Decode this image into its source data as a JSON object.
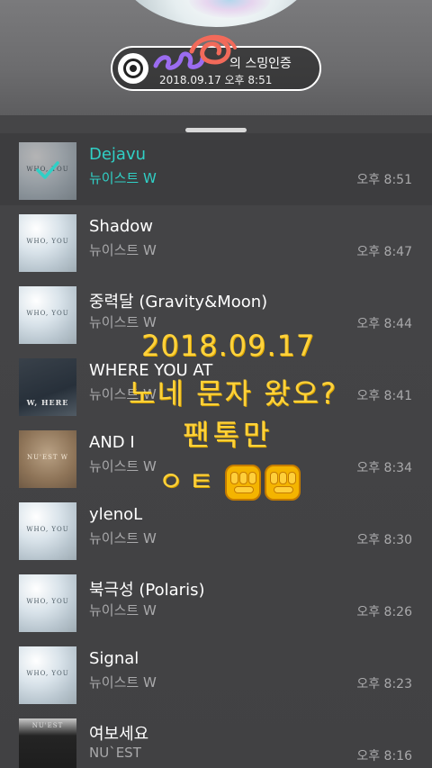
{
  "stream_card": {
    "title_suffix": "의 스밍인증",
    "datetime": "2018.09.17 오후 8:51"
  },
  "songs": [
    {
      "title": "Dejavu",
      "artist": "뉴이스트 W",
      "time": "오후 8:51",
      "cover": "WHO, YOU",
      "playing": true
    },
    {
      "title": "Shadow",
      "artist": "뉴이스트 W",
      "time": "오후 8:47",
      "cover": "WHO, YOU"
    },
    {
      "title": "중력달 (Gravity&Moon)",
      "artist": "뉴이스트 W",
      "time": "오후 8:44",
      "cover": "WHO, YOU"
    },
    {
      "title": "WHERE YOU AT",
      "artist": "뉴이스트 W",
      "time": "오후 8:41",
      "cover": "W, HERE"
    },
    {
      "title": "AND I",
      "artist": "뉴이스트 W",
      "time": "오후 8:34",
      "cover": "NU'EST W"
    },
    {
      "title": "ylenoL",
      "artist": "뉴이스트 W",
      "time": "오후 8:30",
      "cover": "WHO, YOU"
    },
    {
      "title": "북극성 (Polaris)",
      "artist": "뉴이스트 W",
      "time": "오후 8:26",
      "cover": "WHO, YOU"
    },
    {
      "title": "Signal",
      "artist": "뉴이스트 W",
      "time": "오후 8:23",
      "cover": "WHO, YOU"
    },
    {
      "title": "여보세요",
      "artist": "NU`EST",
      "time": "오후 8:16",
      "cover": "NU'EST"
    }
  ],
  "handwriting": {
    "line1": "2018.09.17",
    "line2": "노네 문자 왔오?",
    "line3": "팬톡만",
    "line4": "ㅇㅌ"
  },
  "colors": {
    "accent": "#30d0c6",
    "handwriting": "#ffd23c"
  },
  "icons": {
    "stream": "disc-icon",
    "playing": "check-icon",
    "fist": "raised-fist-icon"
  }
}
